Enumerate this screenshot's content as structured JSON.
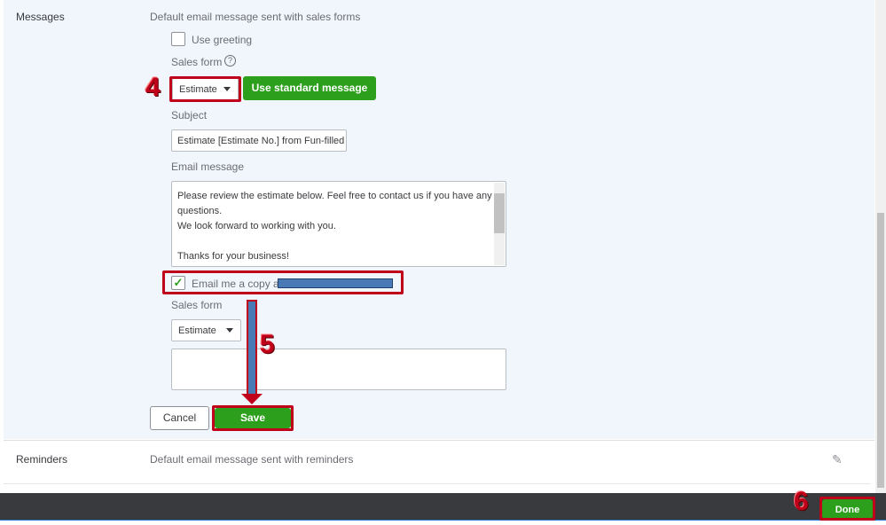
{
  "messages": {
    "section_title": "Messages",
    "description": "Default email message sent with sales forms",
    "use_greeting_label": "Use greeting",
    "use_greeting_checked": false,
    "sales_form_label": "Sales form",
    "help_icon": "?",
    "sales_form_value": "Estimate",
    "use_standard_button": "Use standard message",
    "subject_label": "Subject",
    "subject_value": "Estimate [Estimate No.] from Fun-filled I",
    "email_message_label": "Email message",
    "email_message_lines": [
      "Please review the estimate below.  Feel free to contact us if you have any",
      "questions.",
      "We look forward to working with you.",
      "",
      "Thanks for your business!"
    ],
    "email_copy_label": "Email me a copy at",
    "email_copy_checked": true,
    "sales_form2_label": "Sales form",
    "sales_form2_value": "Estimate",
    "cancel_button": "Cancel",
    "save_button": "Save"
  },
  "reminders": {
    "section_title": "Reminders",
    "description": "Default email message sent with reminders"
  },
  "footer": {
    "done_button": "Done"
  },
  "annotations": {
    "step4": "4",
    "step5": "5",
    "step6": "6"
  },
  "colors": {
    "accent_green": "#2ca01c",
    "annotation_red": "#c0001a",
    "redacted_blue": "#4a7ab5",
    "footer_bg": "#393a3d"
  }
}
